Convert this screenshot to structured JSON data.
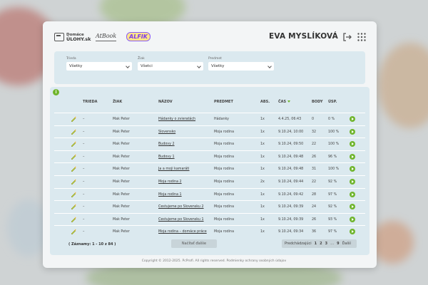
{
  "header": {
    "logos": [
      {
        "name": "domace-ulohy-logo",
        "line1": "Domáce",
        "line2": "ÚLOHY.sk"
      },
      {
        "name": "atbook-logo",
        "text": "AtBook"
      },
      {
        "name": "alfik-logo",
        "text": "ALFIK"
      }
    ],
    "user_name": "EVA MYSLÍKOVÁ"
  },
  "filters": [
    {
      "label": "Trieda",
      "value": "Všetky"
    },
    {
      "label": "Žiak",
      "value": "Všetci"
    },
    {
      "label": "Predmet",
      "value": "Všetky"
    }
  ],
  "table": {
    "columns": [
      "TRIEDA",
      "ŽIAK",
      "NÁZOV",
      "PREDMET",
      "ABS.",
      "ČAS",
      "BODY",
      "ÚSP."
    ],
    "rows": [
      {
        "trieda": "–",
        "ziak": "Mak Peter",
        "nazov": "Hádanky o zvieratách",
        "predmet": "Hádanky",
        "abs": "1x",
        "cas": "4.4.25, 06:43",
        "body": "0",
        "usp": "0 %"
      },
      {
        "trieda": "–",
        "ziak": "Mak Peter",
        "nazov": "Slovensko",
        "predmet": "Moja rodina",
        "abs": "1x",
        "cas": "9.10.24, 10:00",
        "body": "32",
        "usp": "100 %"
      },
      {
        "trieda": "–",
        "ziak": "Mak Peter",
        "nazov": "Budovy 2",
        "predmet": "Moja rodina",
        "abs": "1x",
        "cas": "9.10.24, 09:50",
        "body": "22",
        "usp": "100 %"
      },
      {
        "trieda": "–",
        "ziak": "Mak Peter",
        "nazov": "Budovy 1",
        "predmet": "Moja rodina",
        "abs": "1x",
        "cas": "9.10.24, 09:48",
        "body": "26",
        "usp": "96 %"
      },
      {
        "trieda": "–",
        "ziak": "Mak Peter",
        "nazov": "Ja a moji kamaráti",
        "predmet": "Moja rodina",
        "abs": "1x",
        "cas": "9.10.24, 09:48",
        "body": "31",
        "usp": "100 %"
      },
      {
        "trieda": "–",
        "ziak": "Mak Peter",
        "nazov": "Moja rodina 2",
        "predmet": "Moja rodina",
        "abs": "2x",
        "cas": "9.10.24, 09:44",
        "body": "22",
        "usp": "92 %"
      },
      {
        "trieda": "–",
        "ziak": "Mak Peter",
        "nazov": "Moja rodina 1",
        "predmet": "Moja rodina",
        "abs": "1x",
        "cas": "9.10.24, 09:42",
        "body": "28",
        "usp": "97 %"
      },
      {
        "trieda": "–",
        "ziak": "Mak Peter",
        "nazov": "Cestujeme po Slovensku 2",
        "predmet": "Moja rodina",
        "abs": "1x",
        "cas": "9.10.24, 09:39",
        "body": "24",
        "usp": "92 %"
      },
      {
        "trieda": "–",
        "ziak": "Mak Peter",
        "nazov": "Cestujeme po Slovensku 1",
        "predmet": "Moja rodina",
        "abs": "1x",
        "cas": "9.10.24, 09:39",
        "body": "26",
        "usp": "93 %"
      },
      {
        "trieda": "–",
        "ziak": "Mak Peter",
        "nazov": "Moja rodina – domáce práce",
        "predmet": "Moja rodina",
        "abs": "1x",
        "cas": "9.10.24, 09:34",
        "body": "36",
        "usp": "97 %"
      }
    ]
  },
  "records_text": "( Záznamy: 1 - 10 z 84 )",
  "load_more_label": "Načítať ďalšie",
  "pager": {
    "prev": "Predchádzajúci",
    "pages": [
      "1",
      "2",
      "3",
      "…",
      "9"
    ],
    "next": "Ďalší"
  },
  "footer": "Copyright © 2012-2025. PcProfi. All rights reserved. Podmienky ochrany osobných údajov",
  "colors": {
    "accent": "#6fb52c",
    "panel": "#dbe9ef"
  }
}
